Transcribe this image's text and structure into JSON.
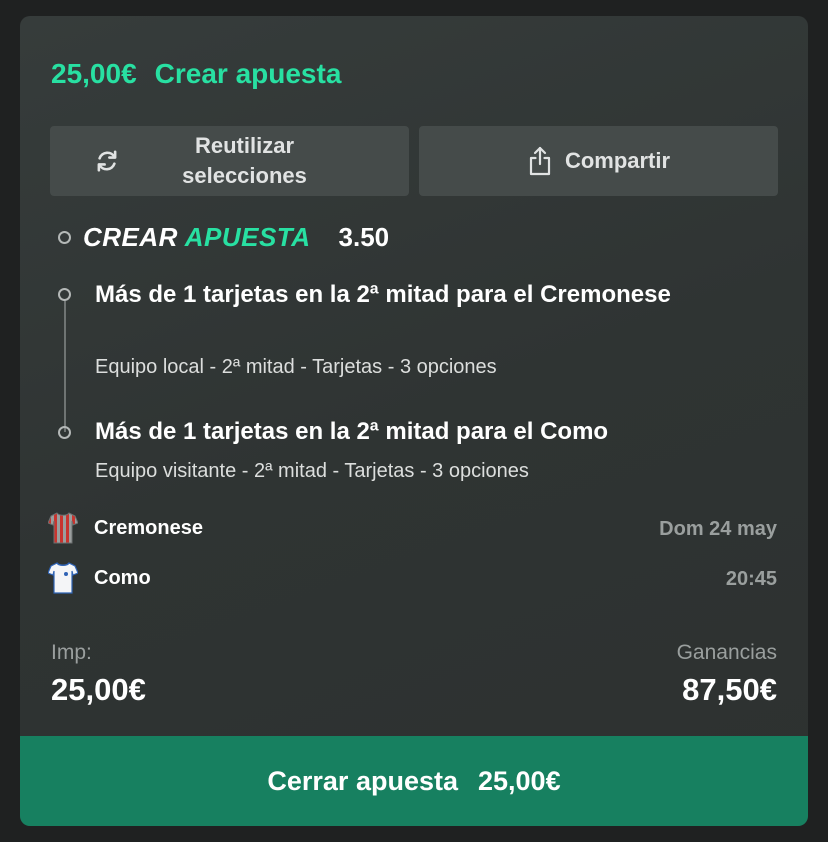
{
  "header": {
    "amount": "25,00€",
    "title": "Crear apuesta"
  },
  "actions": {
    "reuse_label": "Reutilizar selecciones",
    "share_label": "Compartir"
  },
  "betbuilder": {
    "word1": "CREAR",
    "word2": "APUESTA",
    "odds": "3.50"
  },
  "selections": [
    {
      "title": "Más de 1 tarjetas en la 2ª mitad para el Cremonese",
      "subtitle": "Equipo local - 2ª mitad - Tarjetas - 3 opciones"
    },
    {
      "title": "Más de 1 tarjetas en la 2ª mitad para el Como",
      "subtitle": "Equipo visitante - 2ª mitad - Tarjetas - 3 opciones"
    }
  ],
  "match": {
    "home": "Cremonese",
    "away": "Como",
    "date": "Dom 24 may",
    "time": "20:45"
  },
  "stake": {
    "label": "Imp:",
    "value": "25,00€"
  },
  "winnings": {
    "label": "Ganancias",
    "value": "87,50€"
  },
  "cashout": {
    "label": "Cerrar apuesta",
    "amount": "25,00€"
  },
  "colors": {
    "accent": "#28e0a2",
    "cashout_bg": "#178060",
    "card_bg": "#333938"
  },
  "icons": {
    "reuse": "refresh-icon",
    "share": "share-icon",
    "home_kit": "striped-shirt-icon",
    "away_kit": "white-shirt-icon"
  }
}
